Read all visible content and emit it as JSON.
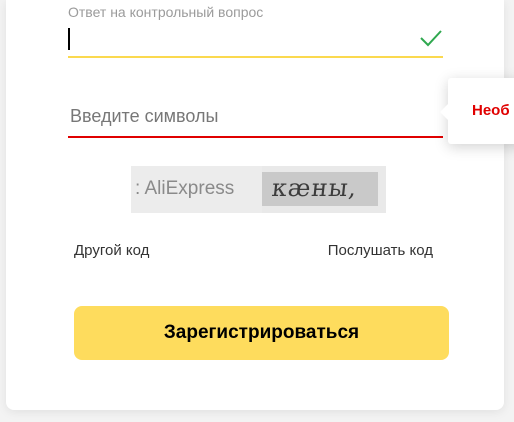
{
  "answer_field": {
    "label": "Ответ на контрольный вопрос",
    "value": "",
    "status": "valid",
    "icon": "check-icon",
    "accent_color": "#fbd94f"
  },
  "captcha_field": {
    "placeholder": "Введите символы",
    "value": "",
    "status": "error",
    "underline_color": "#e00000"
  },
  "error_popup": {
    "text": "Необ"
  },
  "captcha_image": {
    "ad_text": ": AliExpress",
    "word": "кæны,"
  },
  "links": {
    "other_code": "Другой код",
    "listen_code": "Послушать код"
  },
  "register_button": {
    "label": "Зарегистрироваться",
    "color": "#fedc5d"
  }
}
